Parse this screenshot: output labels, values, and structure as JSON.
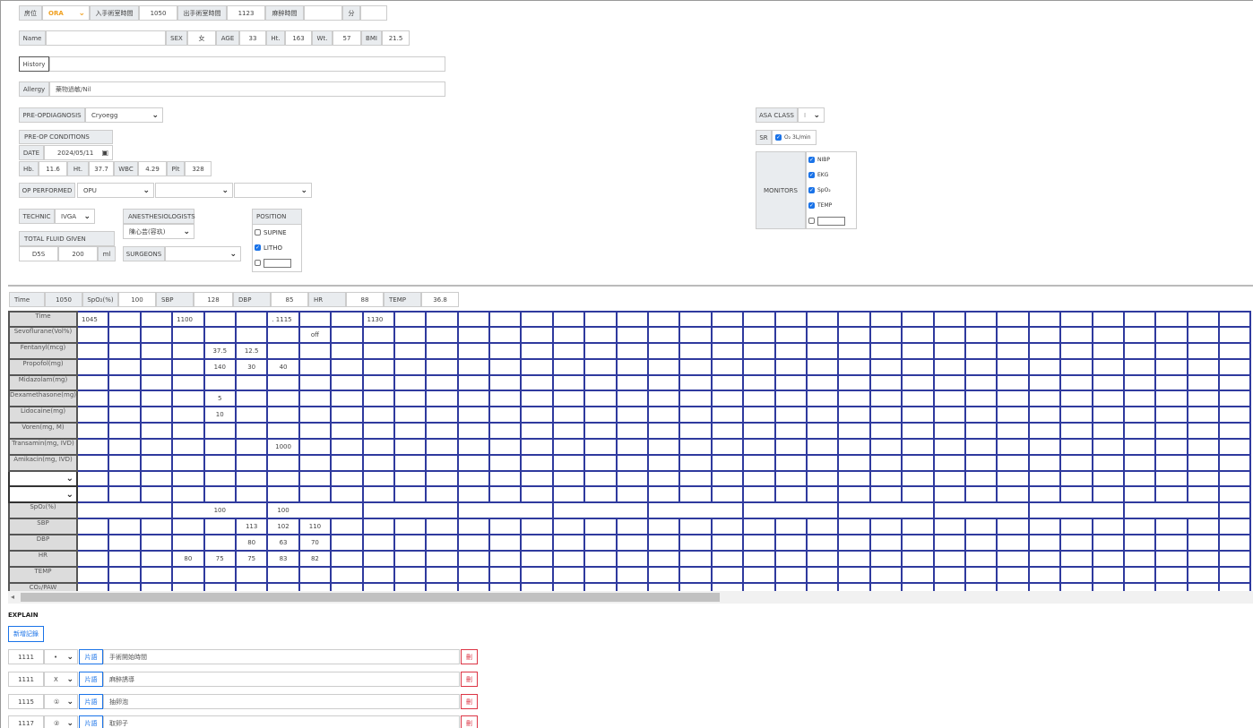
{
  "header": {
    "room_label": "房位",
    "room_value": "ORA",
    "entry_label": "入手術室時間",
    "entry_value": "1050",
    "exit_label": "出手術室時間",
    "exit_value": "1123",
    "anes_time_label": "麻醉時間",
    "anes_time_value": "",
    "min_label": "分",
    "min_value": ""
  },
  "patient": {
    "name_label": "Name",
    "name_value": "",
    "sex_label": "SEX",
    "sex_value": "女",
    "age_label": "AGE",
    "age_value": "33",
    "ht_label": "Ht.",
    "ht_value": "163",
    "wt_label": "Wt.",
    "wt_value": "57",
    "bmi_label": "BMI",
    "bmi_value": "21.5",
    "history_label": "History",
    "history_value": "",
    "allergy_label": "Allergy",
    "allergy_value": "藥物過敏/Nil"
  },
  "preop": {
    "diagnosis_label": "PRE-OPDIAGNOSIS",
    "diagnosis_value": "Cryoegg",
    "conditions_label": "PRE-OP CONDITIONS",
    "date_label": "DATE",
    "date_value": "2024/05/11",
    "hb_label": "Hb.",
    "hb_value": "11.6",
    "ht_label": "Ht.",
    "ht_value": "37.7",
    "wbc_label": "WBC",
    "wbc_value": "4.29",
    "plt_label": "Plt",
    "plt_value": "328",
    "op_label": "OP PERFORMED",
    "op_value": "OPU",
    "op_value2": "",
    "op_value3": ""
  },
  "technic": {
    "label": "TECHNIC",
    "value": "IVGA",
    "fluid_label": "TOTAL FLUID GIVEN",
    "fluid_type": "D5S",
    "fluid_amount": "200",
    "fluid_unit": "ml",
    "anesthesiologists_label": "ANESTHESIOLOGISTS",
    "anesthesiologists_value": "陳心芸(容玖)",
    "surgeons_label": "SURGEONS",
    "surgeons_value": "",
    "position_label": "POSITION",
    "positions": [
      {
        "label": "SUPINE",
        "checked": false
      },
      {
        "label": "LITHO",
        "checked": true
      },
      {
        "label": "",
        "checked": false
      }
    ]
  },
  "asa": {
    "label": "ASA CLASS",
    "value": "I",
    "sr_label": "SR",
    "sr_value": "O₂ 3L/min",
    "monitors_label": "MONITORS",
    "monitors": [
      {
        "label": "NIBP",
        "checked": true
      },
      {
        "label": "EKG",
        "checked": true
      },
      {
        "label": "SpO₂",
        "checked": true
      },
      {
        "label": "TEMP",
        "checked": true
      },
      {
        "label": "",
        "checked": false
      }
    ]
  },
  "vitals_bar": {
    "time_label": "Time",
    "time_value": "1050",
    "spo2_label": "SpO₂(%)",
    "spo2_value": "100",
    "sbp_label": "SBP",
    "sbp_value": "128",
    "dbp_label": "DBP",
    "dbp_value": "85",
    "hr_label": "HR",
    "hr_value": "88",
    "temp_label": "TEMP",
    "temp_value": "36.8"
  },
  "grid": {
    "time_row": [
      "1045",
      "",
      "",
      "1100",
      "",
      "",
      ". 1115",
      "",
      "",
      "1130",
      "",
      "",
      "",
      "",
      "",
      "",
      "",
      "",
      "",
      "",
      "",
      "",
      "",
      "",
      "",
      "",
      "",
      "",
      "",
      "",
      "",
      "",
      "",
      "",
      "",
      ""
    ],
    "rows": [
      {
        "label": "Time"
      },
      {
        "label": "Sevoflurane(Vol%)",
        "cells": {
          "7": "off"
        }
      },
      {
        "label": "Fentanyl(mcg)",
        "cells": {
          "4": "37.5",
          "5": "12.5"
        }
      },
      {
        "label": "Propofol(mg)",
        "cells": {
          "4": "140",
          "5": "30",
          "6": "40"
        }
      },
      {
        "label": "Midazolam(mg)",
        "cells": {}
      },
      {
        "label": "Dexamethasone(mg)",
        "cells": {
          "4": "5"
        }
      },
      {
        "label": "Lidocaine(mg)",
        "cells": {
          "4": "10"
        }
      },
      {
        "label": "Voren(mg, M)",
        "cells": {}
      },
      {
        "label": "Transamin(mg, IVD)",
        "cells": {
          "6": "1000"
        }
      },
      {
        "label": "Amikacin(mg, IVD)",
        "cells": {}
      }
    ],
    "spo2_label": "SpO₂(%)",
    "spo2_values": [
      "100",
      "100"
    ],
    "sbp_label": "SBP",
    "sbp_cells": {
      "5": "113",
      "6": "102",
      "7": "110"
    },
    "dbp_label": "DBP",
    "dbp_cells": {
      "5": "80",
      "6": "63",
      "7": "70"
    },
    "hr_label": "HR",
    "hr_cells": {
      "3": "80",
      "4": "75",
      "5": "75",
      "6": "83",
      "7": "82"
    },
    "temp_label": "TEMP",
    "co2_label": "CO₂/PAW"
  },
  "explain": {
    "title": "EXPLAIN",
    "add_button": "新增記錄",
    "insert_label": "片語",
    "delete_label": "刪",
    "entries": [
      {
        "time": "1111",
        "symbol": "•",
        "text": "手術開始時間"
      },
      {
        "time": "1111",
        "symbol": "X",
        "text": "麻醉誘導"
      },
      {
        "time": "1115",
        "symbol": "①",
        "text": "抽卵泡"
      },
      {
        "time": "1117",
        "symbol": "②",
        "text": "取卵子"
      }
    ]
  },
  "colors": {
    "accent": "#1a73e8",
    "grid": "#2f3a9e",
    "room": "#f0a020",
    "danger": "#dc3545"
  }
}
